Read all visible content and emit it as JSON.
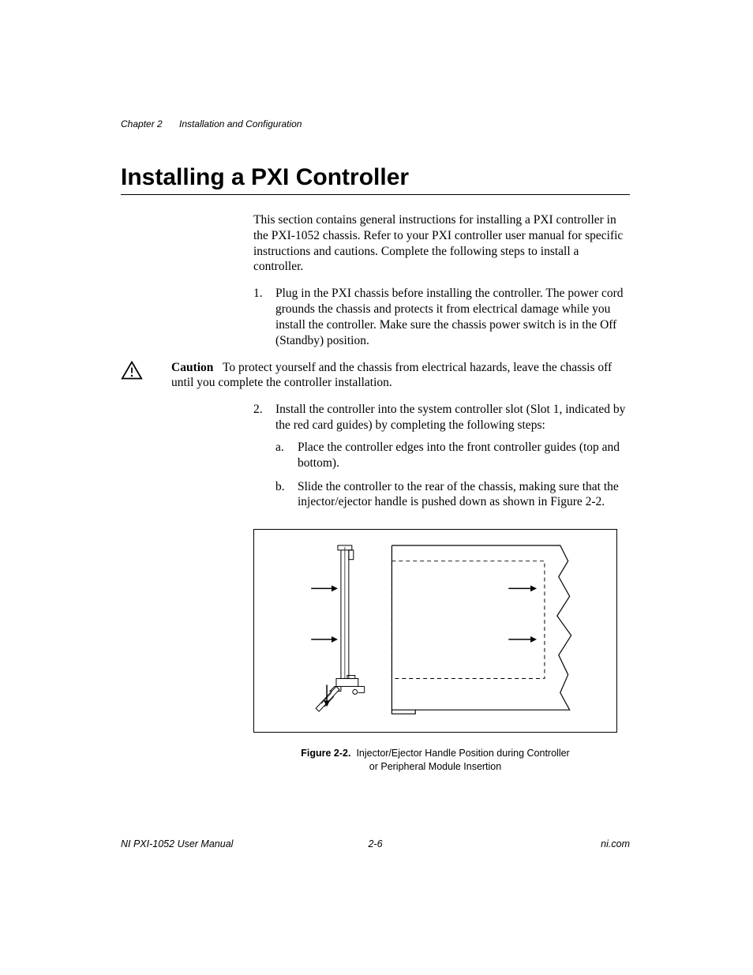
{
  "header": {
    "chapter": "Chapter 2",
    "title": "Installation and Configuration"
  },
  "heading": "Installing a PXI Controller",
  "intro": "This section contains general instructions for installing a PXI controller in the PXI-1052 chassis. Refer to your PXI controller user manual for specific instructions and cautions. Complete the following steps to install a controller.",
  "step1_num": "1.",
  "step1": "Plug in the PXI chassis before installing the controller. The power cord grounds the chassis and protects it from electrical damage while you install the controller. Make sure the chassis power switch is in the Off (Standby) position.",
  "caution_label": "Caution",
  "caution_text": "To protect yourself and the chassis from electrical hazards, leave the chassis off until you complete the controller installation.",
  "step2_num": "2.",
  "step2_intro": "Install the controller into the system controller slot (Slot 1, indicated by the red card guides) by completing the following steps:",
  "step2a_num": "a.",
  "step2a": "Place the controller edges into the front controller guides (top and bottom).",
  "step2b_num": "b.",
  "step2b": "Slide the controller to the rear of the chassis, making sure that the injector/ejector handle is pushed down as shown in Figure 2-2.",
  "figure": {
    "label": "Figure 2-2.",
    "caption_line1": "Injector/Ejector Handle Position during Controller",
    "caption_line2": "or Peripheral Module Insertion"
  },
  "footer": {
    "left": "NI PXI-1052 User Manual",
    "center": "2-6",
    "right": "ni.com"
  }
}
